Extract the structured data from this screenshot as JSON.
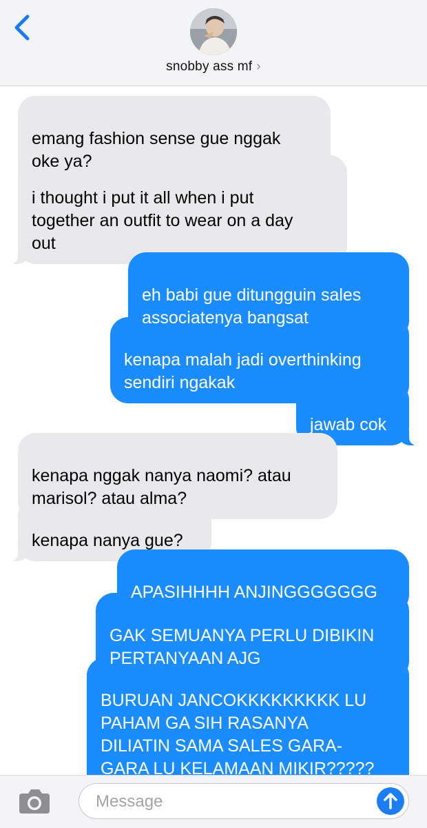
{
  "header": {
    "contact_name": "snobby ass mf",
    "chevron": "›"
  },
  "icons": {
    "back": "chevron-left-icon",
    "camera": "camera-icon",
    "send": "arrow-up-icon"
  },
  "colors": {
    "incoming_bubble": "#e9e9eb",
    "outgoing_bubble": "#1b8cff",
    "accent": "#1b7ef5"
  },
  "messages": [
    {
      "from": "them",
      "text": "emang fashion sense gue nggak\noke ya?"
    },
    {
      "from": "them",
      "text": "i thought i put it all when i put\ntogether an outfit to wear on a day\nout"
    },
    {
      "from": "me",
      "text": "eh babi gue ditungguin sales\nassociatenya bangsat"
    },
    {
      "from": "me",
      "text": "kenapa malah jadi overthinking\nsendiri ngakak"
    },
    {
      "from": "me",
      "text": "jawab cok"
    },
    {
      "from": "them",
      "text": "kenapa nggak nanya naomi? atau\nmarisol? atau alma?"
    },
    {
      "from": "them",
      "text": "kenapa nanya gue?"
    },
    {
      "from": "me",
      "text": "APASIHHHH ANJINGGGGGGG"
    },
    {
      "from": "me",
      "text": "GAK SEMUANYA PERLU DIBIKIN\nPERTANYAAN AJG"
    },
    {
      "from": "me",
      "text": "BURUAN JANCOKKKKKKKKK LU\nPAHAM GA SIH RASANYA\nDILIATIN SAMA SALES GARA-\nGARA LU KELAMAAN MIKIR?????\nYA INI GUE LAGI NGERASAIN TOT"
    }
  ],
  "composer": {
    "placeholder": "Message"
  }
}
